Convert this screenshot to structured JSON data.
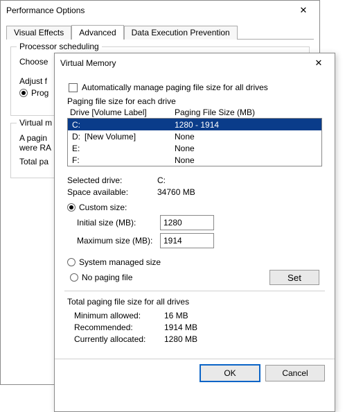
{
  "perf": {
    "title": "Performance Options",
    "tabs": {
      "visual": "Visual Effects",
      "advanced": "Advanced",
      "dep": "Data Execution Prevention"
    },
    "proc_group": "Processor scheduling",
    "choose": "Choose",
    "adjust": "Adjust f",
    "programs": "Prog",
    "vm_group": "Virtual m",
    "paging_desc": "A pagin",
    "were_ra": "were RA",
    "total_pa": "Total pa"
  },
  "vm": {
    "title": "Virtual Memory",
    "auto_manage": "Automatically manage paging file size for all drives",
    "each_drive": "Paging file size for each drive",
    "drive_hdr": "Drive  [Volume Label]",
    "size_hdr": "Paging File Size (MB)",
    "drives": [
      {
        "letter": "C:",
        "vol": "",
        "size": "1280 - 1914",
        "sel": true
      },
      {
        "letter": "D:",
        "vol": "[New Volume]",
        "size": "None",
        "sel": false
      },
      {
        "letter": "E:",
        "vol": "",
        "size": "None",
        "sel": false
      },
      {
        "letter": "F:",
        "vol": "",
        "size": "None",
        "sel": false
      }
    ],
    "selected_drive_l": "Selected drive:",
    "selected_drive_v": "C:",
    "space_l": "Space available:",
    "space_v": "34760 MB",
    "custom": "Custom size:",
    "initial_l": "Initial size (MB):",
    "initial_v": "1280",
    "max_l": "Maximum size (MB):",
    "max_v": "1914",
    "system_managed": "System managed size",
    "no_paging": "No paging file",
    "set": "Set",
    "totals_head": "Total paging file size for all drives",
    "min_l": "Minimum allowed:",
    "min_v": "16 MB",
    "rec_l": "Recommended:",
    "rec_v": "1914 MB",
    "cur_l": "Currently allocated:",
    "cur_v": "1280 MB",
    "ok": "OK",
    "cancel": "Cancel"
  }
}
